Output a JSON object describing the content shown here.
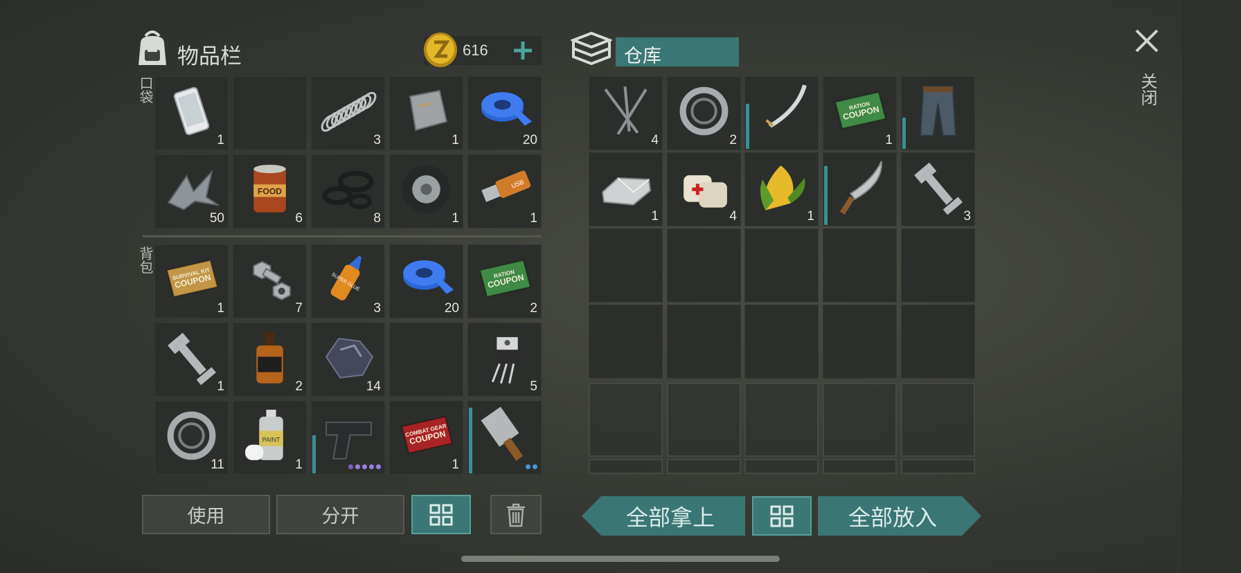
{
  "inventory": {
    "title": "物品栏",
    "currency": "616",
    "pocket_label": "口袋",
    "backpack_label": "背包",
    "pocket_slots": [
      {
        "icon": "phone-icon",
        "count": "1"
      },
      {
        "icon": "empty",
        "count": ""
      },
      {
        "icon": "spring-icon",
        "count": "3"
      },
      {
        "icon": "metal-plate-icon",
        "count": "1"
      },
      {
        "icon": "blue-tape-icon",
        "count": "20"
      },
      {
        "icon": "scrap-metal-icon",
        "count": "50"
      },
      {
        "icon": "food-can-icon",
        "count": "6"
      },
      {
        "icon": "rubber-rings-icon",
        "count": "8"
      },
      {
        "icon": "tire-icon",
        "count": "1"
      },
      {
        "icon": "usb-drive-icon",
        "count": "1"
      }
    ],
    "backpack_slots": [
      {
        "icon": "survival-kit-coupon-icon",
        "count": "1"
      },
      {
        "icon": "bolt-nut-icon",
        "count": "7"
      },
      {
        "icon": "super-glue-icon",
        "count": "3"
      },
      {
        "icon": "blue-tape-icon",
        "count": "20"
      },
      {
        "icon": "ration-coupon-icon",
        "count": "2"
      },
      {
        "icon": "wrench-icon",
        "count": "1"
      },
      {
        "icon": "whiskey-bottle-icon",
        "count": "2"
      },
      {
        "icon": "ore-icon",
        "count": "14"
      },
      {
        "icon": "empty",
        "count": ""
      },
      {
        "icon": "transistor-icon",
        "count": "5"
      },
      {
        "icon": "bearing-icon",
        "count": "11"
      },
      {
        "icon": "spray-paint-icon",
        "count": "1"
      },
      {
        "icon": "pistol-icon",
        "count": "",
        "durability": 0.55,
        "dots": [
          "#7f5fc0",
          "#9b7fe0",
          "#9b7fe0",
          "#9b7fe0",
          "#9b7fe0"
        ]
      },
      {
        "icon": "combat-gear-coupon-icon",
        "count": "1"
      },
      {
        "icon": "cleaver-icon",
        "count": "",
        "durability": 0.95,
        "dots": [
          "#2c2f2b",
          "#4f97d6",
          "#4f97d6"
        ]
      }
    ],
    "coupon_texts": {
      "ration_top": "RATION",
      "coupon": "COUPON",
      "survival": "SURVIVAL KIT",
      "combat": "COMBAT GEAR",
      "food": "FOOD",
      "usb": "USB",
      "glue": "SUPER GLUE",
      "paint": "PAINT"
    },
    "buttons": {
      "use": "使用",
      "split": "分开"
    }
  },
  "storage": {
    "title": "仓库",
    "slots": [
      {
        "icon": "nails-icon",
        "count": "4"
      },
      {
        "icon": "bearing-icon",
        "count": "2"
      },
      {
        "icon": "katana-icon",
        "count": "",
        "durability": 0.65
      },
      {
        "icon": "ration-coupon-icon",
        "count": "1"
      },
      {
        "icon": "pants-icon",
        "count": "",
        "durability": 0.45
      },
      {
        "icon": "silver-ingot-icon",
        "count": "1"
      },
      {
        "icon": "bandage-icon",
        "count": "4"
      },
      {
        "icon": "corn-icon",
        "count": "1"
      },
      {
        "icon": "machete-icon",
        "count": "",
        "durability": 0.85,
        "dots": [
          "#2c2f2b",
          "#2c2f2b",
          "#2c2f2b"
        ]
      },
      {
        "icon": "wrench-icon",
        "count": "3"
      }
    ],
    "buttons": {
      "take_all": "全部拿上",
      "put_all": "全部放入"
    }
  },
  "close_label": "关闭",
  "colors": {
    "accent": "#3a7673",
    "accent_border": "#5ba09a",
    "count_text": "#e6e6e0",
    "durability": "#3a8f96"
  }
}
